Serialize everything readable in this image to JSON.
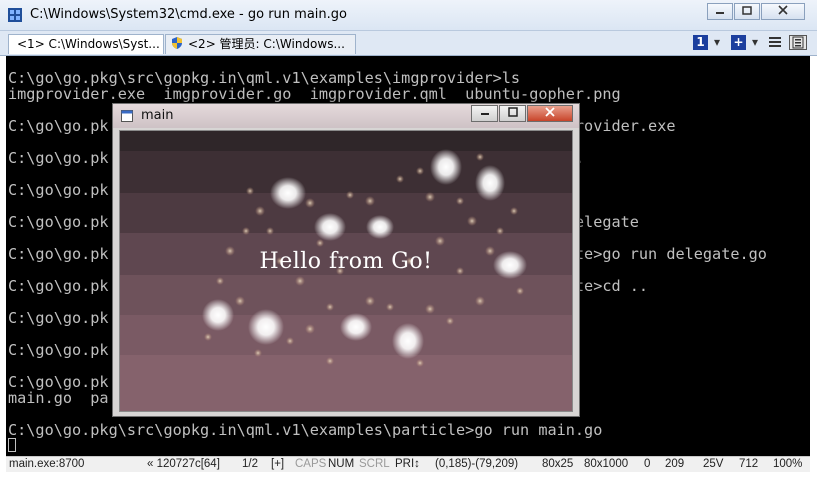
{
  "window": {
    "title": "C:\\Windows\\System32\\cmd.exe - go  run main.go",
    "caption_buttons": [
      "minimize",
      "restore",
      "close"
    ]
  },
  "tabs": [
    {
      "label": "<1> C:\\Windows\\Syst..."
    },
    {
      "label": "<2> 管理员: C:\\Windows..."
    }
  ],
  "tab_tools": {
    "console_number": "1",
    "plus": "+",
    "dropdown": "▾"
  },
  "console": {
    "lines": [
      "C:\\go\\go.pkg\\src\\gopkg.in\\qml.v1\\examples\\imgprovider>ls",
      "imgprovider.exe  imgprovider.go  imgprovider.qml  ubuntu-gopher.png",
      "",
      "C:\\go\\go.pk                                                  provider.exe",
      "",
      "C:\\go\\go.pk                                                  ..",
      "",
      "C:\\go\\go.pk",
      "",
      "C:\\go\\go.pk                                                  delegate",
      "",
      "C:\\go\\go.pk                                                  ate>go run delegate.go",
      "",
      "C:\\go\\go.pk                                                  ate>cd ..",
      "",
      "C:\\go\\go.pk",
      "",
      "C:\\go\\go.pk",
      "",
      "C:\\go\\go.pk",
      "main.go  pa",
      "",
      "C:\\go\\go.pkg\\src\\gopkg.in\\qml.v1\\examples\\particle>go run main.go"
    ]
  },
  "statusbar": {
    "process": "main.exe:8700",
    "buffer": "« 120727c[64]",
    "page": "1/2",
    "plus": "[+]",
    "caps": "CAPS",
    "num": "NUM",
    "scrl": "SCRL",
    "pri": "PRI↕",
    "selection": "(0,185)-(79,209)",
    "size": "80x25",
    "buffer_size": "80x1000",
    "zero": "0",
    "line": "209",
    "volume": "25V",
    "code": "712",
    "zoom": "100%"
  },
  "inner_window": {
    "title": "main",
    "message": "Hello from Go!"
  },
  "colors": {
    "console_bg": "#000000",
    "console_text": "#c0c0c0",
    "band_dark": "#3a2c30",
    "band_light": "#7f5c66"
  }
}
